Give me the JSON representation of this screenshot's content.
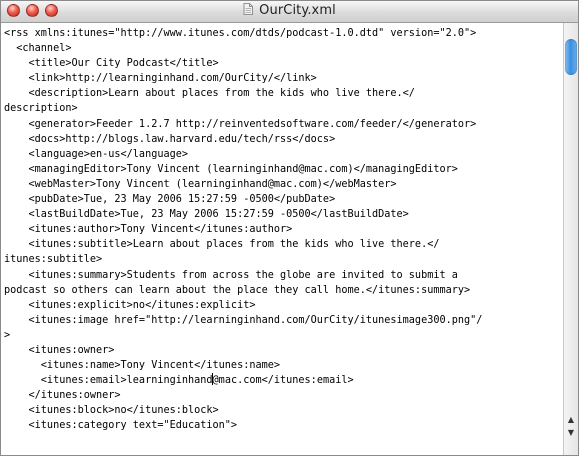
{
  "window": {
    "title": "OurCity.xml",
    "buttons": [
      "close",
      "minimize",
      "zoom"
    ]
  },
  "icons": {
    "document": "document-icon",
    "scroll_up": "arrow-up-icon",
    "scroll_down": "arrow-down-icon"
  },
  "colors": {
    "close": "#f25c4e",
    "scroll_thumb": "#3a8fe0"
  },
  "editor": {
    "lines": [
      "<rss xmlns:itunes=\"http://www.itunes.com/dtds/podcast-1.0.dtd\" version=\"2.0\">",
      "  <channel>",
      "    <title>Our City Podcast</title>",
      "    <link>http://learninginhand.com/OurCity/</link>",
      "    <description>Learn about places from the kids who live there.</",
      "description>",
      "    <generator>Feeder 1.2.7 http://reinventedsoftware.com/feeder/</generator>",
      "    <docs>http://blogs.law.harvard.edu/tech/rss</docs>",
      "    <language>en-us</language>",
      "    <managingEditor>Tony Vincent (learninginhand@mac.com)</managingEditor>",
      "    <webMaster>Tony Vincent (learninginhand@mac.com)</webMaster>",
      "    <pubDate>Tue, 23 May 2006 15:27:59 -0500</pubDate>",
      "    <lastBuildDate>Tue, 23 May 2006 15:27:59 -0500</lastBuildDate>",
      "    <itunes:author>Tony Vincent</itunes:author>",
      "    <itunes:subtitle>Learn about places from the kids who live there.</",
      "itunes:subtitle>",
      "    <itunes:summary>Students from across the globe are invited to submit a",
      "podcast so others can learn about the place they call home.</itunes:summary>",
      "    <itunes:explicit>no</itunes:explicit>",
      "    <itunes:image href=\"http://learninginhand.com/OurCity/itunesimage300.png\"/",
      ">",
      "    <itunes:owner>",
      "      <itunes:name>Tony Vincent</itunes:name>",
      "      <itunes:email>learninginhand",
      "@mac.com</itunes:email>",
      "    </itunes:owner>",
      "    <itunes:block>no</itunes:block>",
      "    <itunes:category text=\"Education\">"
    ]
  }
}
